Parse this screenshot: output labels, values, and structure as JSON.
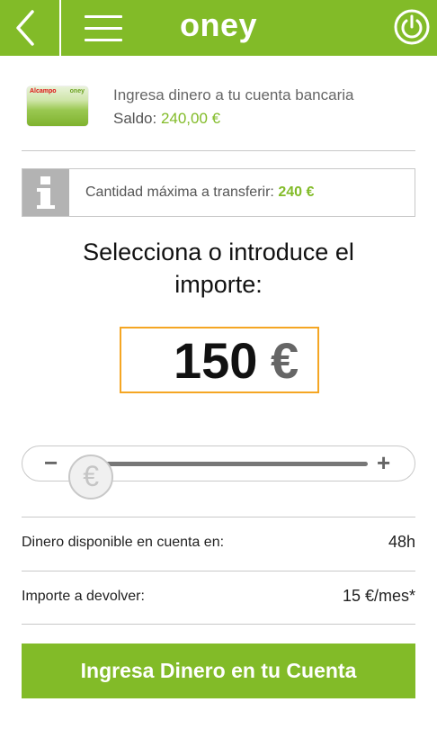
{
  "header": {
    "logo_text": "oney",
    "back_icon": "chevron-left-icon",
    "menu_icon": "hamburger-icon",
    "power_icon": "power-icon"
  },
  "card": {
    "brand_text": "Alcampo",
    "brand_oney": "oney",
    "title": "Ingresa dinero a tu cuenta bancaria",
    "balance_label": "Saldo:",
    "balance_value": "240,00 €"
  },
  "info": {
    "icon": "info-icon",
    "label": "Cantidad máxima a transferir:",
    "value": "240 €"
  },
  "select": {
    "title": "Selecciona o introduce el importe:"
  },
  "amount": {
    "value": "150",
    "currency": "€"
  },
  "slider": {
    "minus": "−",
    "plus": "+",
    "thumb_symbol": "€",
    "fraction": 0.05
  },
  "rows": [
    {
      "label": "Dinero disponible en cuenta en:",
      "value": "48h"
    },
    {
      "label": "Importe a devolver:",
      "value": "15 €/mes*"
    }
  ],
  "cta": {
    "label": "Ingresa Dinero en tu Cuenta"
  },
  "colors": {
    "brand_green": "#82bb28",
    "accent_orange": "#f5a623"
  }
}
